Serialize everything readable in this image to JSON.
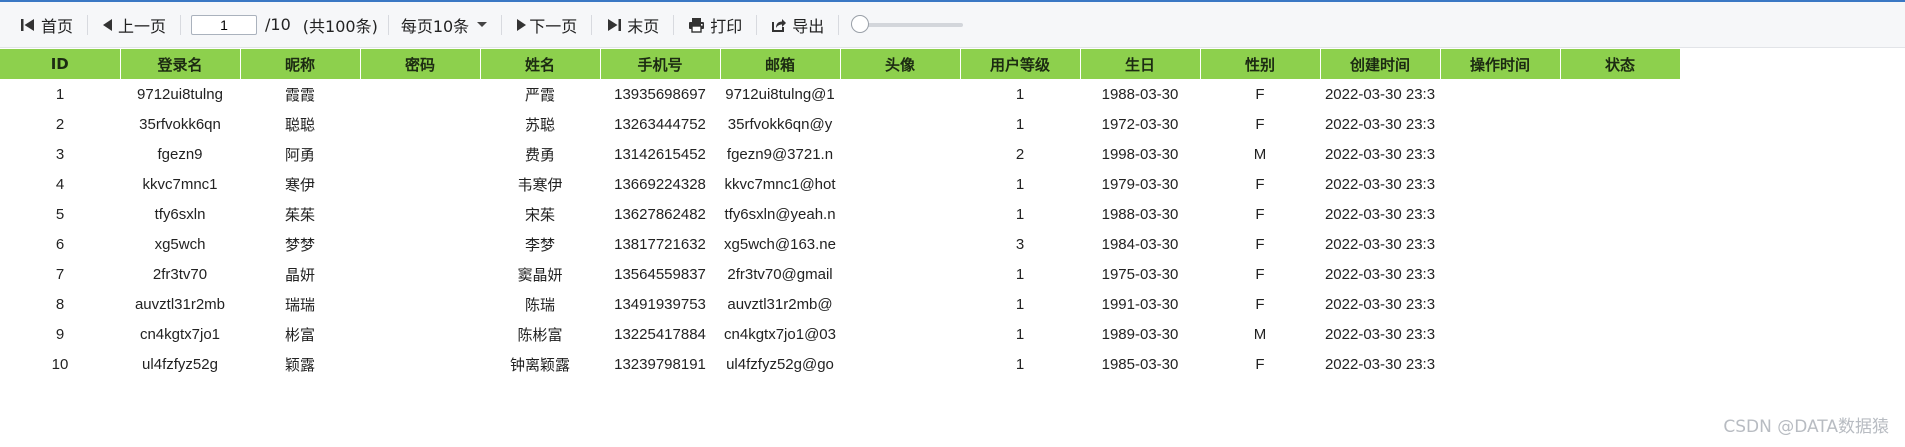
{
  "toolbar": {
    "first_label": "首页",
    "prev_label": "上一页",
    "page_value": "1",
    "page_total": "/10",
    "record_count": "(共100条)",
    "page_size_label": "每页10条",
    "next_label": "下一页",
    "last_label": "末页",
    "print_label": "打印",
    "export_label": "导出",
    "slider_value": 0
  },
  "table": {
    "headers": [
      "ID",
      "登录名",
      "昵称",
      "密码",
      "姓名",
      "手机号",
      "邮箱",
      "头像",
      "用户等级",
      "生日",
      "性别",
      "创建时间",
      "操作时间",
      "状态"
    ],
    "rows": [
      [
        "1",
        "9712ui8tulng",
        "霞霞",
        "",
        "严霞",
        "13935698697",
        "9712ui8tulng@1",
        "",
        "1",
        "1988-03-30",
        "F",
        "2022-03-30 23:3",
        "",
        ""
      ],
      [
        "2",
        "35rfvokk6qn",
        "聪聪",
        "",
        "苏聪",
        "13263444752",
        "35rfvokk6qn@y",
        "",
        "1",
        "1972-03-30",
        "F",
        "2022-03-30 23:3",
        "",
        ""
      ],
      [
        "3",
        "fgezn9",
        "阿勇",
        "",
        "费勇",
        "13142615452",
        "fgezn9@3721.n",
        "",
        "2",
        "1998-03-30",
        "M",
        "2022-03-30 23:3",
        "",
        ""
      ],
      [
        "4",
        "kkvc7mnc1",
        "寒伊",
        "",
        "韦寒伊",
        "13669224328",
        "kkvc7mnc1@hot",
        "",
        "1",
        "1979-03-30",
        "F",
        "2022-03-30 23:3",
        "",
        ""
      ],
      [
        "5",
        "tfy6sxln",
        "茱茱",
        "",
        "宋茱",
        "13627862482",
        "tfy6sxln@yeah.n",
        "",
        "1",
        "1988-03-30",
        "F",
        "2022-03-30 23:3",
        "",
        ""
      ],
      [
        "6",
        "xg5wch",
        "梦梦",
        "",
        "李梦",
        "13817721632",
        "xg5wch@163.ne",
        "",
        "3",
        "1984-03-30",
        "F",
        "2022-03-30 23:3",
        "",
        ""
      ],
      [
        "7",
        "2fr3tv70",
        "晶妍",
        "",
        "窦晶妍",
        "13564559837",
        "2fr3tv70@gmail",
        "",
        "1",
        "1975-03-30",
        "F",
        "2022-03-30 23:3",
        "",
        ""
      ],
      [
        "8",
        "auvztl31r2mb",
        "瑞瑞",
        "",
        "陈瑞",
        "13491939753",
        "auvztl31r2mb@",
        "",
        "1",
        "1991-03-30",
        "F",
        "2022-03-30 23:3",
        "",
        ""
      ],
      [
        "9",
        "cn4kgtx7jo1",
        "彬富",
        "",
        "陈彬富",
        "13225417884",
        "cn4kgtx7jo1@03",
        "",
        "1",
        "1989-03-30",
        "M",
        "2022-03-30 23:3",
        "",
        ""
      ],
      [
        "10",
        "ul4fzfyz52g",
        "颖露",
        "",
        "钟离颖露",
        "13239798191",
        "ul4fzfyz52g@go",
        "",
        "1",
        "1985-03-30",
        "F",
        "2022-03-30 23:3",
        "",
        ""
      ]
    ]
  },
  "watermark": "CSDN @DATA数据猿",
  "colors": {
    "header_bg": "#8dd04d",
    "toolbar_bg": "#f6f7f9",
    "accent_line": "#3a78c4"
  },
  "icons": [
    "first-page-icon",
    "prev-page-icon",
    "next-page-icon",
    "last-page-icon",
    "printer-icon",
    "export-icon"
  ]
}
